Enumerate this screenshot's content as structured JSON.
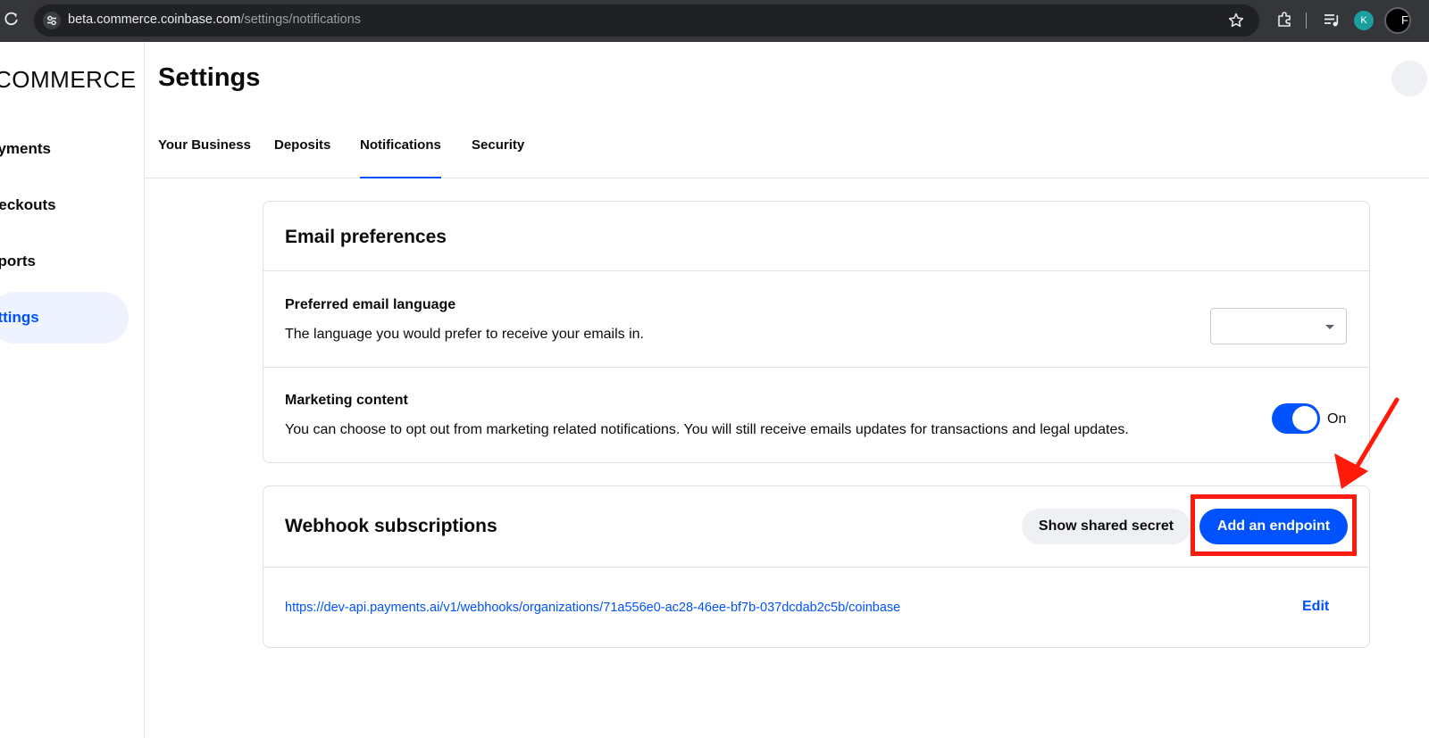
{
  "browser": {
    "url_host": "beta.commerce.coinbase.com",
    "url_path": "/settings/notifications",
    "profile_initial": "K",
    "profile2_initial": "F"
  },
  "sidebar": {
    "brand": "COMMERCE",
    "items": [
      {
        "label": "Payments",
        "visible": "ayments"
      },
      {
        "label": "Checkouts",
        "visible": "heckouts"
      },
      {
        "label": "Reports",
        "visible": "eports"
      },
      {
        "label": "Settings",
        "visible": "ettings",
        "active": true
      }
    ]
  },
  "header": {
    "title": "Settings",
    "tabs": [
      {
        "label": "Your Business"
      },
      {
        "label": "Deposits"
      },
      {
        "label": "Notifications",
        "active": true
      },
      {
        "label": "Security"
      }
    ]
  },
  "email_preferences": {
    "title": "Email preferences",
    "language": {
      "title": "Preferred email language",
      "description": "The language you would prefer to receive your emails in.",
      "selected": ""
    },
    "marketing": {
      "title": "Marketing content",
      "description": "You can choose to opt out from marketing related notifications. You will still receive emails updates for transactions and legal updates.",
      "toggle_on": true,
      "toggle_label": "On"
    }
  },
  "webhooks": {
    "title": "Webhook subscriptions",
    "show_secret_label": "Show shared secret",
    "add_endpoint_label": "Add an endpoint",
    "endpoint_url": "https://dev-api.payments.ai/v1/webhooks/organizations/71a556e0-ac28-46ee-bf7b-037dcdab2c5b/coinbase",
    "edit_label": "Edit"
  },
  "colors": {
    "accent": "#0052ff",
    "annotation": "#ff1a0a",
    "active_nav_bg": "#eef3ff"
  }
}
